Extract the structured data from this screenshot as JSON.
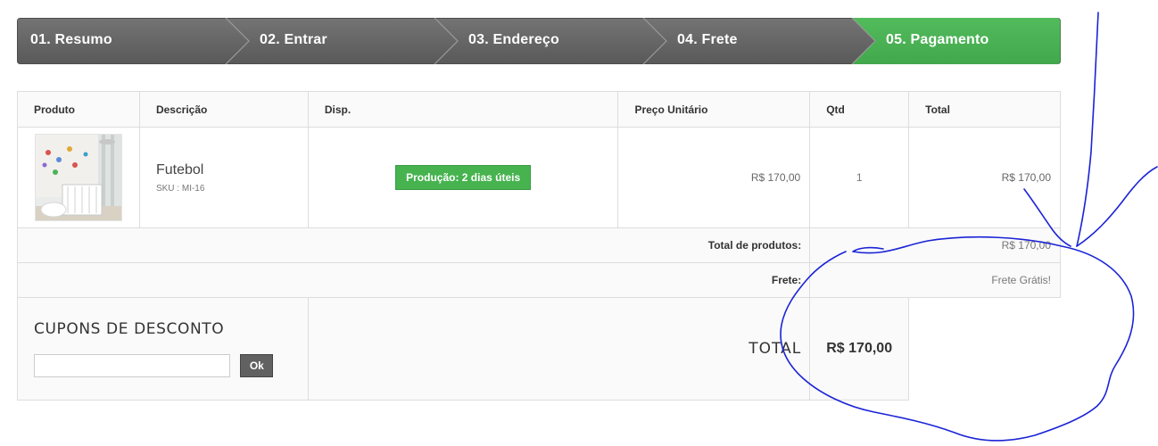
{
  "steps": [
    {
      "label": "01. Resumo",
      "state": "inactive"
    },
    {
      "label": "02. Entrar",
      "state": "inactive"
    },
    {
      "label": "03. Endereço",
      "state": "inactive"
    },
    {
      "label": "04. Frete",
      "state": "inactive"
    },
    {
      "label": "05. Pagamento",
      "state": "active"
    }
  ],
  "colors": {
    "step_inactive": "#676767",
    "step_active": "#4cb356",
    "availability": "#46b34f",
    "annotation": "#1a23d6"
  },
  "table": {
    "headers": {
      "produto": "Produto",
      "descricao": "Descrição",
      "disp": "Disp.",
      "preco_unitario": "Preço Unitário",
      "qtd": "Qtd",
      "total": "Total"
    },
    "items": [
      {
        "name": "Futebol",
        "sku": "SKU : MI-16",
        "availability": "Produção: 2 dias úteis",
        "unit_price": "R$ 170,00",
        "qty": "1",
        "total": "R$ 170,00"
      }
    ]
  },
  "summary": {
    "products_label": "Total de produtos:",
    "products_value": "R$ 170,00",
    "shipping_label": "Frete:",
    "shipping_value": "Frete Grátis!"
  },
  "coupon": {
    "title": "CUPONS DE DESCONTO",
    "input_value": "",
    "button_label": "Ok"
  },
  "grand_total": {
    "label": "TOTAL",
    "value": "R$ 170,00"
  }
}
